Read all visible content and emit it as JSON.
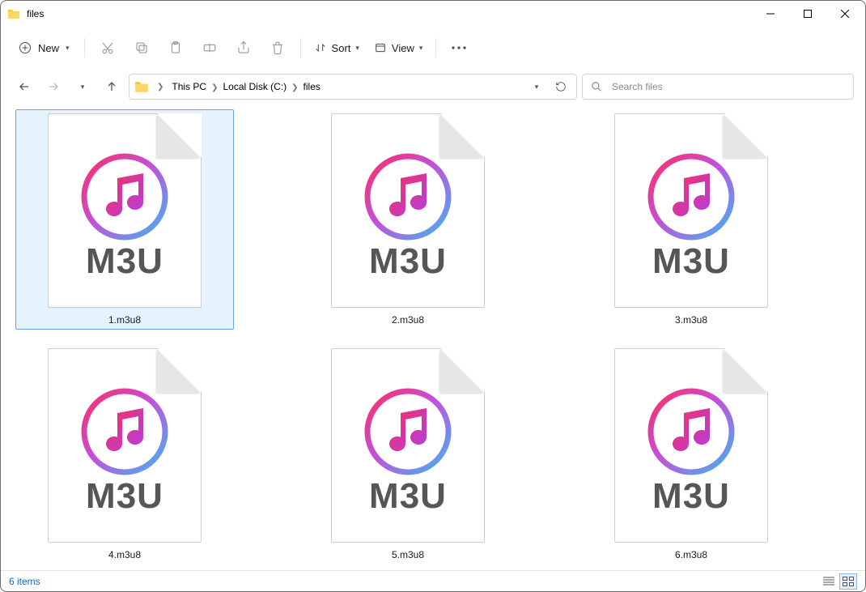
{
  "window": {
    "title": "files"
  },
  "toolbar": {
    "new_label": "New",
    "sort_label": "Sort",
    "view_label": "View"
  },
  "breadcrumbs": [
    "This PC",
    "Local Disk (C:)",
    "files"
  ],
  "search": {
    "placeholder": "Search files"
  },
  "files": [
    {
      "name": "1.m3u8",
      "type_label": "M3U",
      "selected": true
    },
    {
      "name": "2.m3u8",
      "type_label": "M3U",
      "selected": false
    },
    {
      "name": "3.m3u8",
      "type_label": "M3U",
      "selected": false
    },
    {
      "name": "4.m3u8",
      "type_label": "M3U",
      "selected": false
    },
    {
      "name": "5.m3u8",
      "type_label": "M3U",
      "selected": false
    },
    {
      "name": "6.m3u8",
      "type_label": "M3U",
      "selected": false
    }
  ],
  "status": {
    "item_count_label": "6 items"
  }
}
